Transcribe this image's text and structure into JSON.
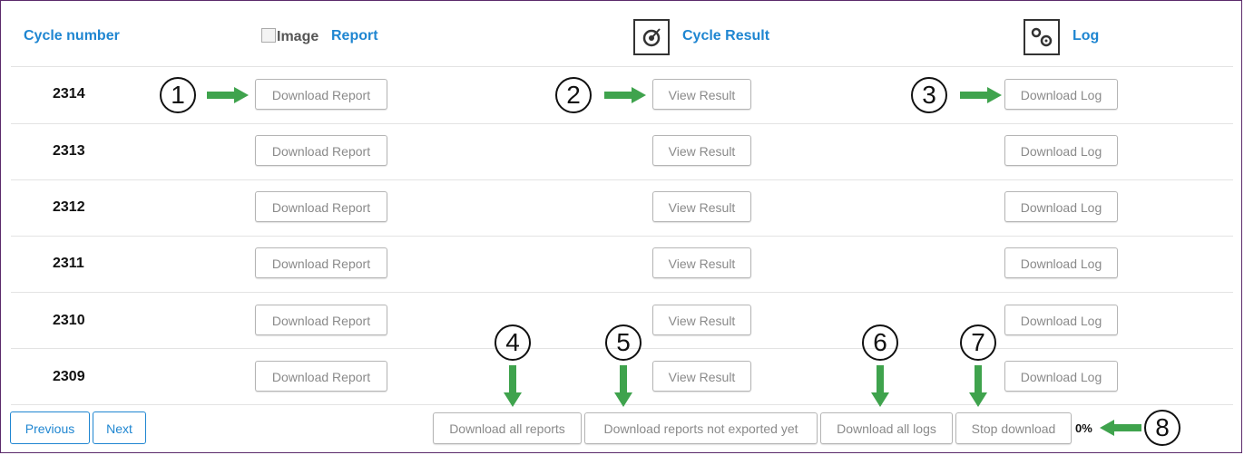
{
  "header": {
    "cycle_number": "Cycle number",
    "image_broken_alt": "Image",
    "report": "Report",
    "cycle_result": "Cycle Result",
    "log": "Log",
    "cycle_result_icon": "target-icon",
    "log_icon": "gears-icon"
  },
  "rows": [
    {
      "cycle": "2314",
      "report_btn": "Download Report",
      "result_btn": "View Result",
      "log_btn": "Download Log"
    },
    {
      "cycle": "2313",
      "report_btn": "Download Report",
      "result_btn": "View Result",
      "log_btn": "Download Log"
    },
    {
      "cycle": "2312",
      "report_btn": "Download Report",
      "result_btn": "View Result",
      "log_btn": "Download Log"
    },
    {
      "cycle": "2311",
      "report_btn": "Download Report",
      "result_btn": "View Result",
      "log_btn": "Download Log"
    },
    {
      "cycle": "2310",
      "report_btn": "Download Report",
      "result_btn": "View Result",
      "log_btn": "Download Log"
    },
    {
      "cycle": "2309",
      "report_btn": "Download Report",
      "result_btn": "View Result",
      "log_btn": "Download Log"
    }
  ],
  "pagination": {
    "previous": "Previous",
    "next": "Next"
  },
  "footer_actions": {
    "download_all_reports": "Download all reports",
    "download_not_exported": "Download reports not exported yet",
    "download_all_logs": "Download all logs",
    "stop_download": "Stop download",
    "progress": "0%"
  },
  "callouts": [
    "1",
    "2",
    "3",
    "4",
    "5",
    "6",
    "7",
    "8"
  ],
  "colors": {
    "accent": "#1f86d1",
    "arrow": "#3fa34d",
    "frame": "#5b2a6b"
  }
}
